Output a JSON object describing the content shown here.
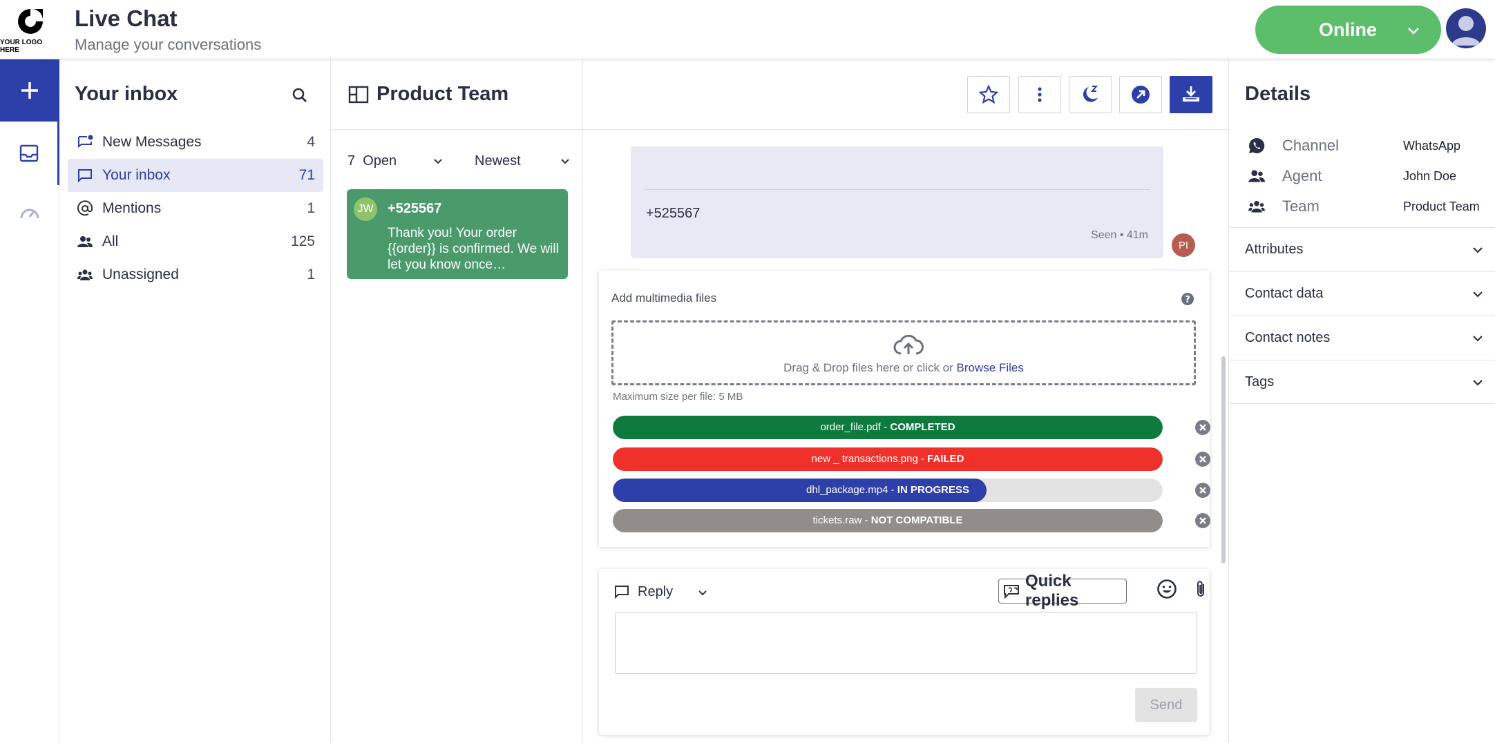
{
  "header": {
    "logo_text": "YOUR LOGO HERE",
    "title": "Live Chat",
    "subtitle": "Manage your conversations",
    "status": "Online"
  },
  "rail": {
    "icons": [
      "plus-icon",
      "inbox-icon",
      "dashboard-icon"
    ]
  },
  "inbox": {
    "title": "Your inbox",
    "items": [
      {
        "label": "New Messages",
        "count": "4",
        "icon": "new-message-icon"
      },
      {
        "label": "Your inbox",
        "count": "71",
        "icon": "chat-icon",
        "active": true
      },
      {
        "label": "Mentions",
        "count": "1",
        "icon": "at-icon"
      },
      {
        "label": "All",
        "count": "125",
        "icon": "people-icon"
      },
      {
        "label": "Unassigned",
        "count": "1",
        "icon": "group-icon"
      }
    ]
  },
  "conversations": {
    "team": "Product Team",
    "filter_count": "7",
    "filter_status": "Open",
    "sort": "Newest",
    "items": [
      {
        "initials": "JW",
        "name": "+525567",
        "preview": "Thank you! Your order {{order}} is confirmed. We will let you know once…"
      }
    ]
  },
  "chat": {
    "toolbar": [
      "star-icon",
      "more-vertical-icon",
      "snooze-icon",
      "share-icon",
      "download-icon"
    ],
    "message": {
      "number": "+525567",
      "meta": "Seen • 41m",
      "avatar": "PI"
    },
    "upload": {
      "title": "Add multimedia files",
      "drop_text": "Drag & Drop files here or click or ",
      "drop_link": "Browse Files",
      "max_size": "Maximum size per file: 5 MB",
      "files": [
        {
          "name": "order_file.pdf - ",
          "status": "COMPLETED",
          "color": "#0e7a3d",
          "progress": 1.0
        },
        {
          "name": "new _ transactions.png - ",
          "status": "FAILED",
          "color": "#f0302a",
          "progress": 1.0
        },
        {
          "name": "dhl_package.mp4 - ",
          "status": "IN PROGRESS",
          "color": "#2d3fa8",
          "progress": 0.68
        },
        {
          "name": "tickets.raw - ",
          "status": "NOT COMPATIBLE",
          "color": "#928d8a",
          "progress": 1.0
        }
      ]
    },
    "reply": {
      "mode": "Reply",
      "quick_replies": "Quick replies",
      "input_value": "",
      "send": "Send"
    }
  },
  "details": {
    "title": "Details",
    "fields": [
      {
        "key": "Channel",
        "value": "WhatsApp",
        "icon": "whatsapp-icon"
      },
      {
        "key": "Agent",
        "value": "John Doe",
        "icon": "people-icon"
      },
      {
        "key": "Team",
        "value": "Product Team",
        "icon": "group-icon"
      }
    ],
    "sections": [
      "Attributes",
      "Contact data",
      "Contact notes",
      "Tags"
    ]
  },
  "colors": {
    "primary": "#2d3fa8",
    "online": "#5cbd6b",
    "conversation_card": "#4a9a6c"
  }
}
